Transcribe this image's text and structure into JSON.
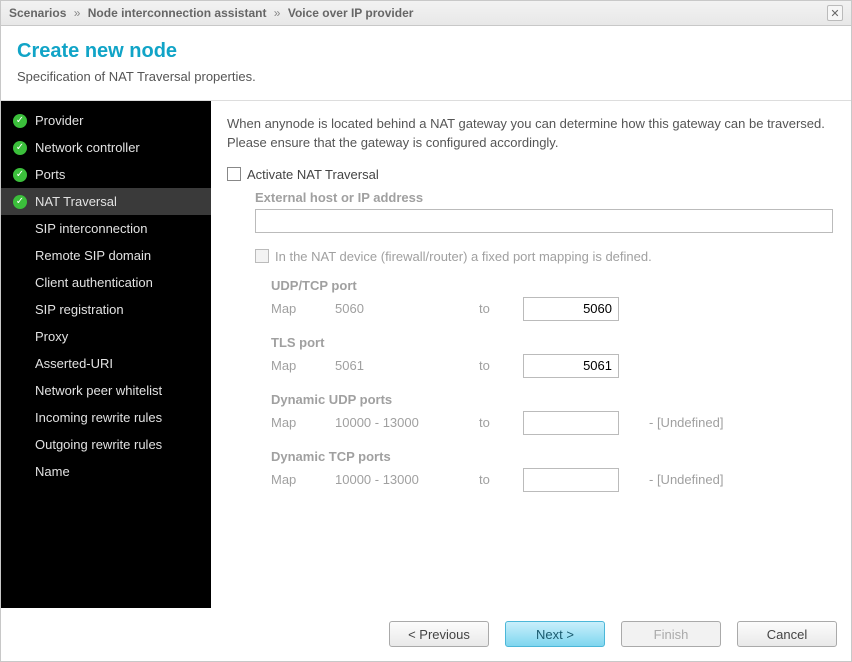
{
  "breadcrumb": {
    "part1": "Scenarios",
    "part2": "Node interconnection assistant",
    "part3": "Voice over IP provider"
  },
  "header": {
    "title": "Create new node",
    "subtitle": "Specification of NAT Traversal properties."
  },
  "sidebar": {
    "items": [
      {
        "label": "Provider",
        "done": true,
        "active": false
      },
      {
        "label": "Network controller",
        "done": true,
        "active": false
      },
      {
        "label": "Ports",
        "done": true,
        "active": false
      },
      {
        "label": "NAT Traversal",
        "done": true,
        "active": true
      },
      {
        "label": "SIP interconnection",
        "done": false,
        "active": false
      },
      {
        "label": "Remote SIP domain",
        "done": false,
        "active": false
      },
      {
        "label": "Client authentication",
        "done": false,
        "active": false
      },
      {
        "label": "SIP registration",
        "done": false,
        "active": false
      },
      {
        "label": "Proxy",
        "done": false,
        "active": false
      },
      {
        "label": "Asserted-URI",
        "done": false,
        "active": false
      },
      {
        "label": "Network peer whitelist",
        "done": false,
        "active": false
      },
      {
        "label": "Incoming rewrite rules",
        "done": false,
        "active": false
      },
      {
        "label": "Outgoing rewrite rules",
        "done": false,
        "active": false
      },
      {
        "label": "Name",
        "done": false,
        "active": false
      }
    ]
  },
  "content": {
    "intro": "When anynode is located behind a NAT gateway you can determine how this gateway can be traversed. Please ensure that the gateway is configured accordingly.",
    "activate_label": "Activate NAT Traversal",
    "activate_checked": false,
    "external_host_label": "External host or IP address",
    "external_host_value": "",
    "fixed_mapping_label": "In the NAT device (firewall/router) a fixed port mapping is defined.",
    "fixed_mapping_checked": false,
    "map_word": "Map",
    "to_word": "to",
    "undefined_suffix": "- [Undefined]",
    "ports": {
      "udp_tcp": {
        "title": "UDP/TCP port",
        "src": "5060",
        "dst": "5060"
      },
      "tls": {
        "title": "TLS port",
        "src": "5061",
        "dst": "5061"
      },
      "dyn_udp": {
        "title": "Dynamic UDP ports",
        "src": "10000 - 13000",
        "dst": ""
      },
      "dyn_tcp": {
        "title": "Dynamic TCP ports",
        "src": "10000 - 13000",
        "dst": ""
      }
    }
  },
  "footer": {
    "previous": "< Previous",
    "next": "Next >",
    "finish": "Finish",
    "cancel": "Cancel"
  }
}
